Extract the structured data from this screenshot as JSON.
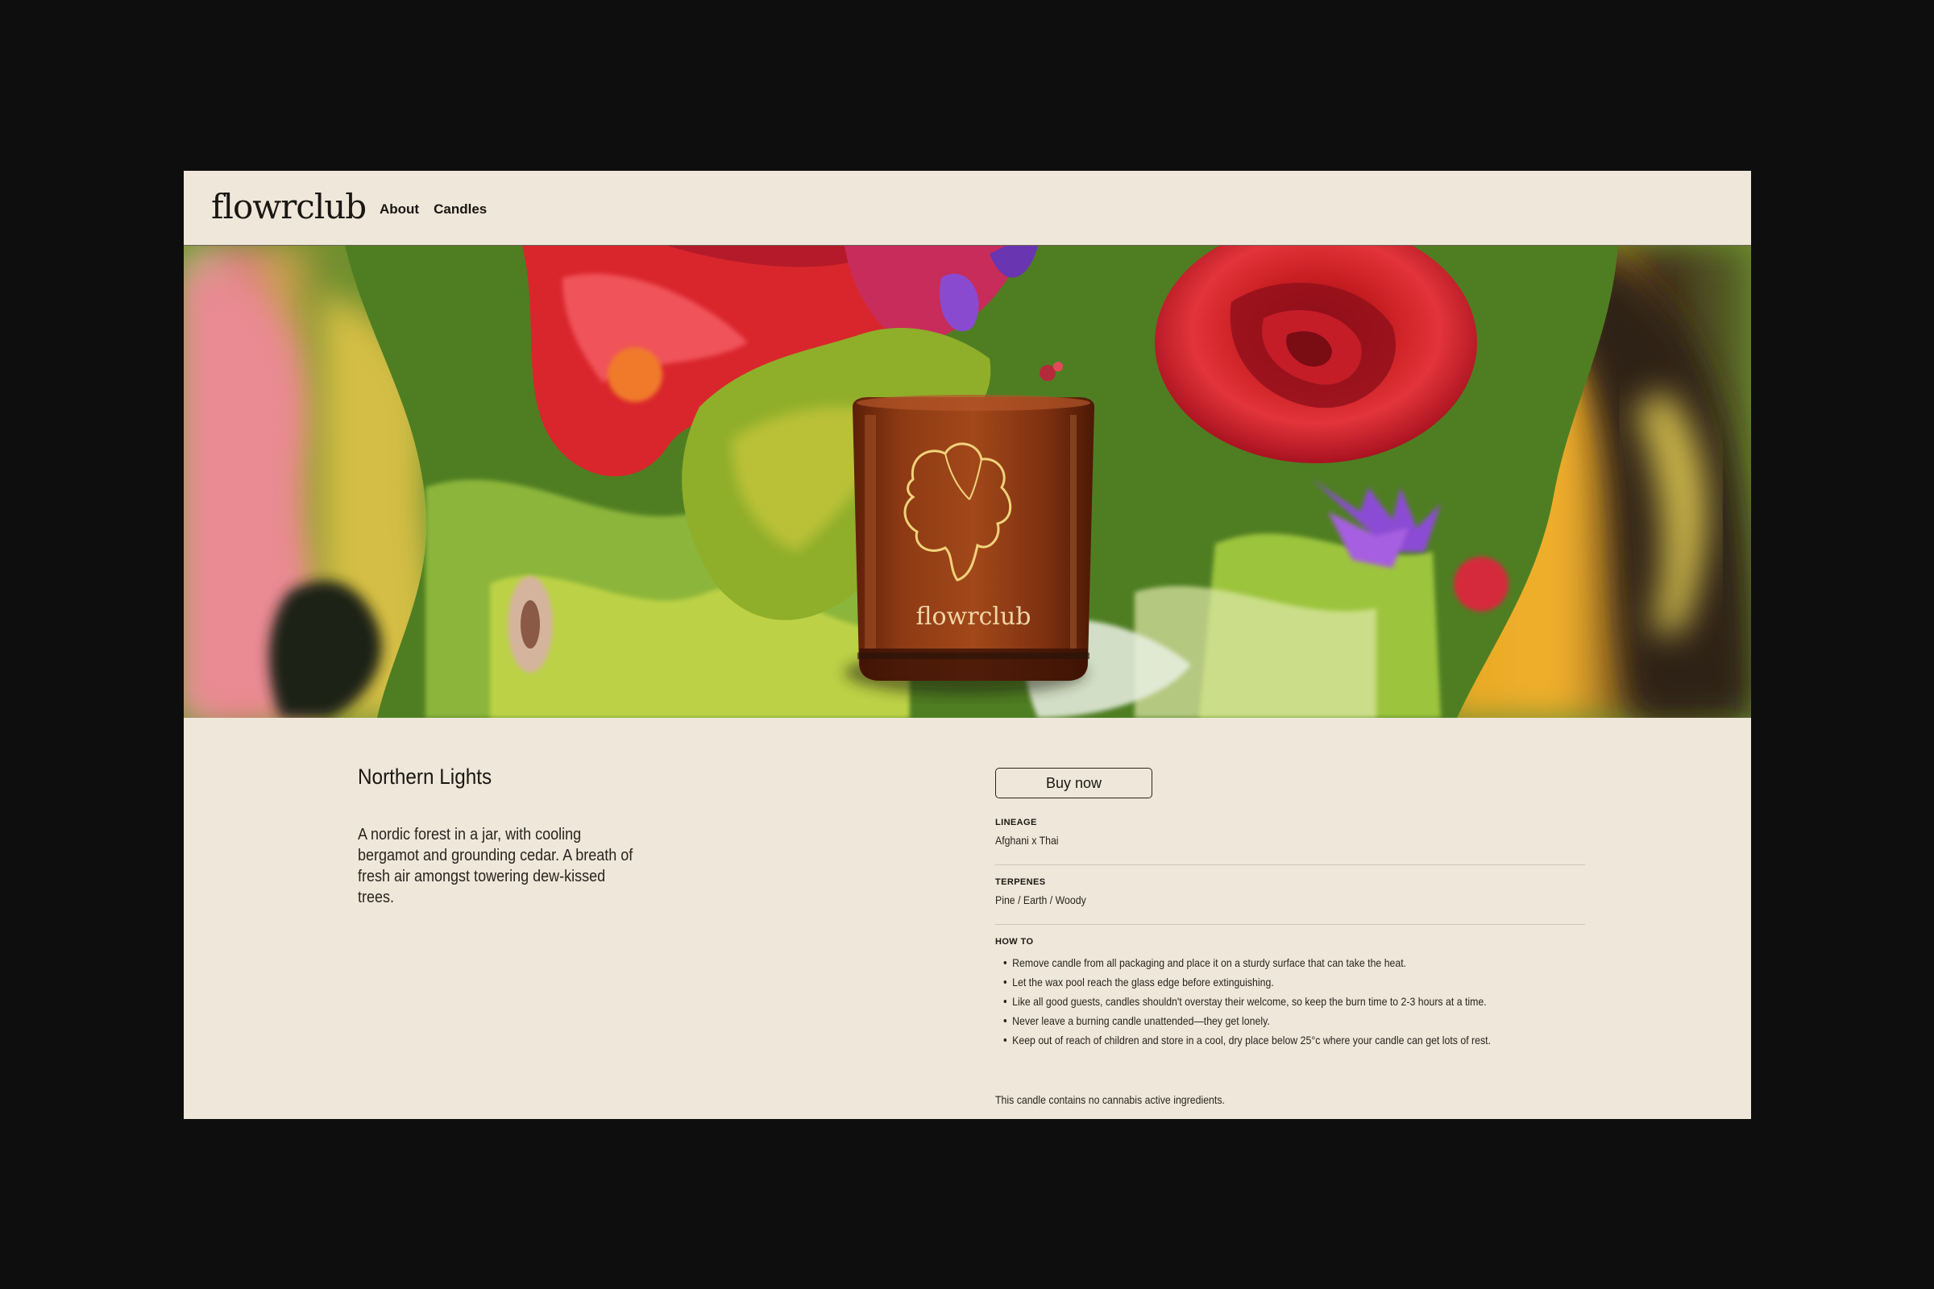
{
  "brand": {
    "logo": "flowrclub"
  },
  "nav": {
    "items": [
      {
        "label": "About"
      },
      {
        "label": "Candles"
      }
    ]
  },
  "hero": {
    "candle_label": "flowrclub",
    "image_description": "floral collage hero"
  },
  "product": {
    "title": "Northern Lights",
    "description": "A nordic forest in a jar, with cooling bergamot and grounding cedar. A breath of fresh air amongst towering dew-kissed trees.",
    "buy_label": "Buy now",
    "lineage": {
      "label": "LINEAGE",
      "value": "Afghani x Thai"
    },
    "terpenes": {
      "label": "TERPENES",
      "value": "Pine / Earth / Woody"
    },
    "howto": {
      "label": "HOW TO",
      "items": [
        "Remove candle from all packaging and place it on a sturdy surface that can take the heat.",
        "Let the wax pool reach the glass edge before extinguishing.",
        "Like all good guests, candles shouldn't overstay their welcome, so keep the burn time to 2-3 hours at a time.",
        "Never leave a burning candle unattended—they get lonely.",
        "Keep out of reach of children and store in a cool, dry place below 25°c where your candle can get lots of rest."
      ]
    },
    "footnote": "This candle contains no cannabis active ingredients."
  },
  "colors": {
    "page_bg": "#0e0e0e",
    "panel_bg": "#efe7da",
    "text": "#1a1612",
    "candle_glass": "#8a3814",
    "candle_outline": "#f2d27a"
  }
}
